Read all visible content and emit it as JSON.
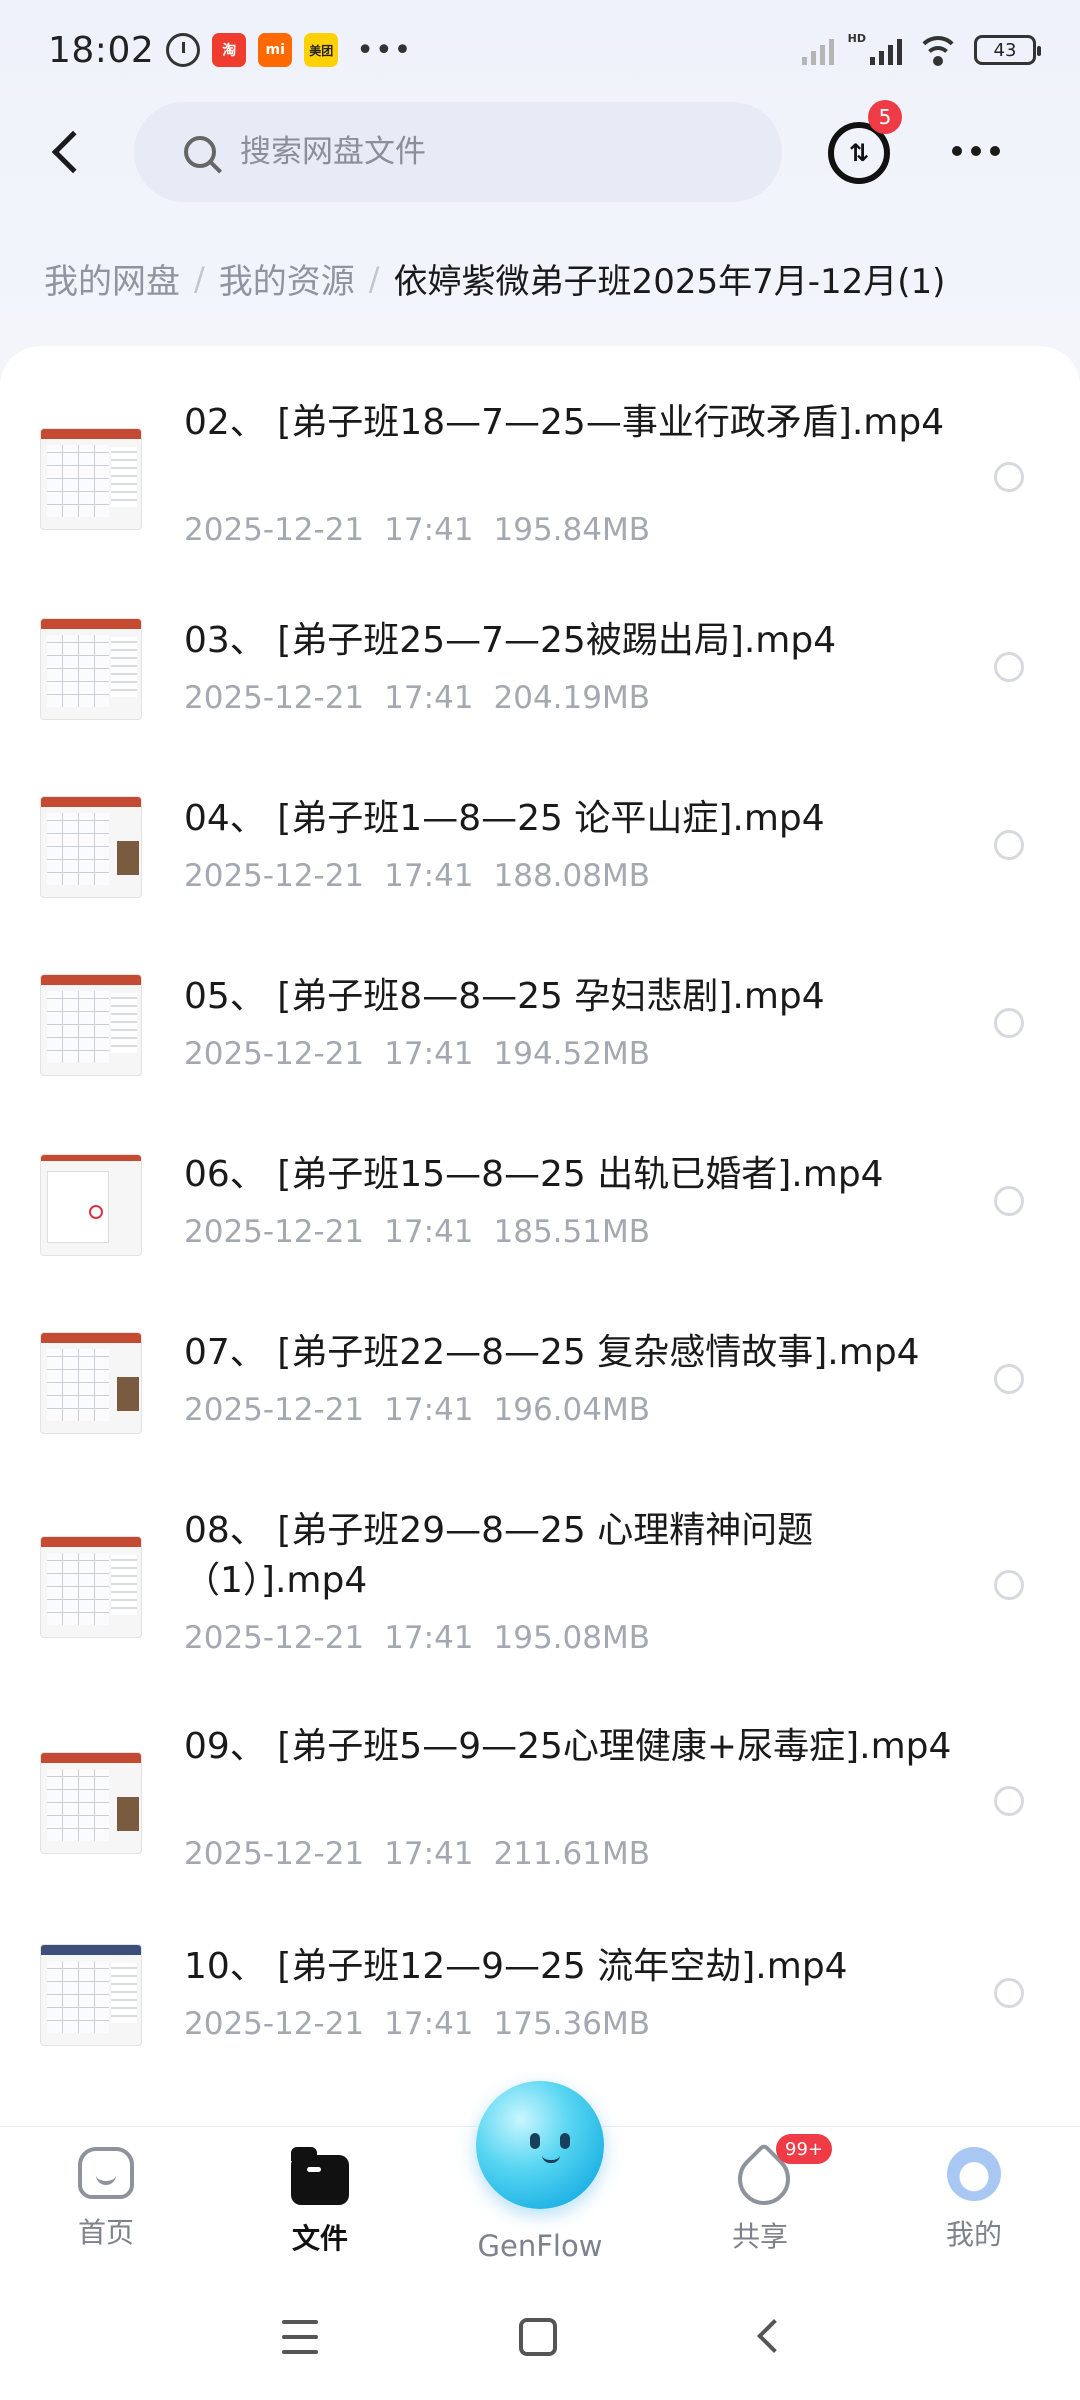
{
  "status_bar": {
    "time": "18:02",
    "apps": [
      {
        "name": "taobao-icon",
        "text": "淘",
        "color": "#f03c2e"
      },
      {
        "name": "mi-icon",
        "text": "mi",
        "color": "#ff6900"
      },
      {
        "name": "meituan-icon",
        "text": "美团",
        "color": "#ffd100"
      }
    ],
    "dots": "•••",
    "hd": "HD",
    "battery": "43"
  },
  "header": {
    "search_placeholder": "搜索网盘文件",
    "transfer_badge": "5",
    "transfer_glyph": "⇅"
  },
  "breadcrumb": {
    "items": [
      "我的网盘",
      "我的资源",
      "依婷紫微弟子班2025年7月-12月(1)"
    ],
    "separator": "/"
  },
  "files": [
    {
      "name": "02、 [弟子班18—7—25—事业行政矛盾].mp4",
      "date": "2025-12-21",
      "time": "17:41",
      "size": "195.84MB"
    },
    {
      "name": "03、 [弟子班25—7—25被踢出局].mp4",
      "date": "2025-12-21",
      "time": "17:41",
      "size": "204.19MB"
    },
    {
      "name": "04、 [弟子班1—8—25 论平山症].mp4",
      "date": "2025-12-21",
      "time": "17:41",
      "size": "188.08MB"
    },
    {
      "name": "05、 [弟子班8—8—25 孕妇悲剧].mp4",
      "date": "2025-12-21",
      "time": "17:41",
      "size": "194.52MB"
    },
    {
      "name": "06、 [弟子班15—8—25 出轨已婚者].mp4",
      "date": "2025-12-21",
      "time": "17:41",
      "size": "185.51MB"
    },
    {
      "name": "07、 [弟子班22—8—25 复杂感情故事].mp4",
      "date": "2025-12-21",
      "time": "17:41",
      "size": "196.04MB"
    },
    {
      "name": "08、 [弟子班29—8—25 心理精神问题（1）].mp4",
      "date": "2025-12-21",
      "time": "17:41",
      "size": "195.08MB"
    },
    {
      "name": "09、 [弟子班5—9—25心理健康+尿毒症].mp4",
      "date": "2025-12-21",
      "time": "17:41",
      "size": "211.61MB"
    },
    {
      "name": "10、 [弟子班12—9—25 流年空劫].mp4",
      "date": "2025-12-21",
      "time": "17:41",
      "size": "175.36MB"
    }
  ],
  "bottom_nav": {
    "home": "首页",
    "files": "文件",
    "genflow": "GenFlow",
    "share": "共享",
    "share_badge": "99+",
    "me": "我的"
  }
}
